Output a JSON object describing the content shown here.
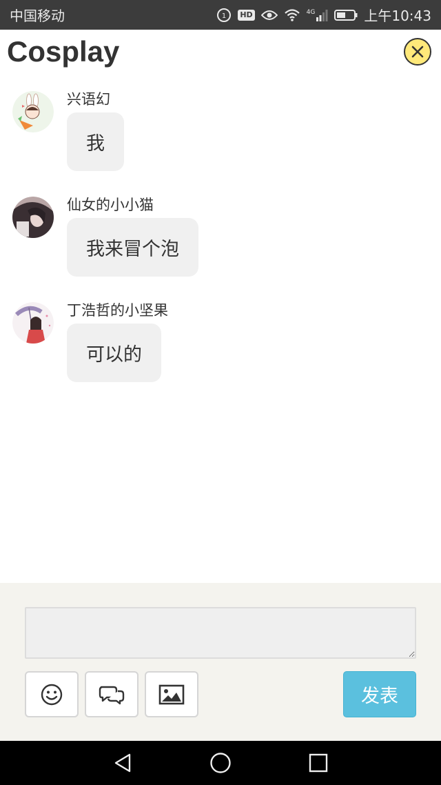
{
  "statusbar": {
    "carrier": "中国移动",
    "network": "4G",
    "time": "上午10:43",
    "hd": "HD"
  },
  "header": {
    "title": "Cosplay",
    "close_icon": "close-x-icon"
  },
  "messages": [
    {
      "sender": "兴语幻",
      "text": "我"
    },
    {
      "sender": "仙女的小小猫",
      "text": "我来冒个泡"
    },
    {
      "sender": "丁浩哲的小坚果",
      "text": "可以的"
    }
  ],
  "composer": {
    "input_value": "",
    "send_label": "发表",
    "tools": [
      "emoji-icon",
      "chat-bubbles-icon",
      "image-icon"
    ]
  },
  "colors": {
    "accent": "#5bc0de",
    "close_bg": "#ffe97a",
    "bubble_bg": "#f0f0f0",
    "composer_bg": "#f4f3ee"
  }
}
